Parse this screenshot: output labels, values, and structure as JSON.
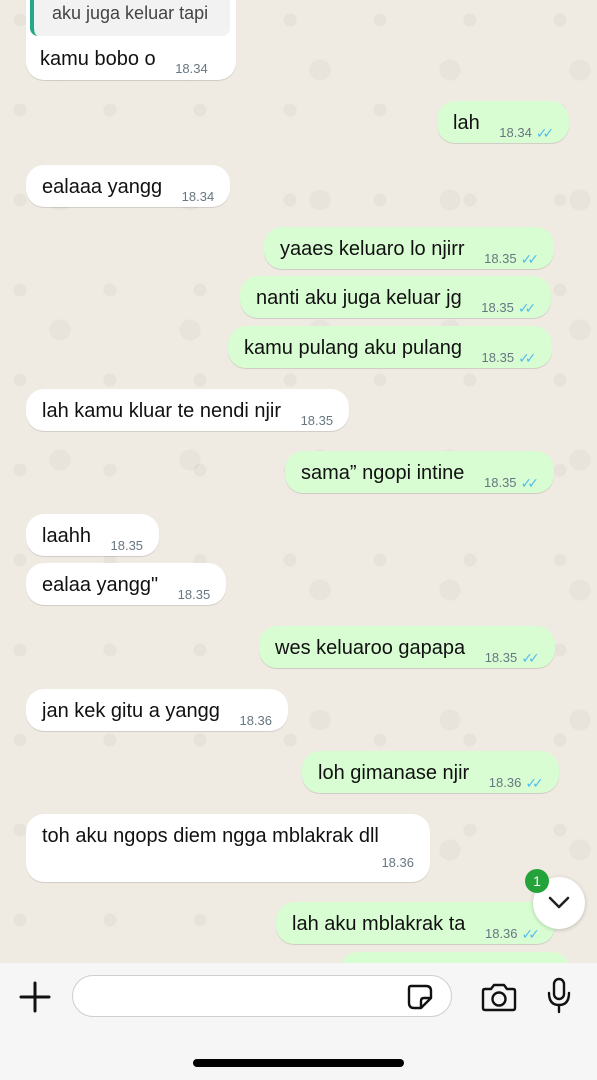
{
  "reply_quote": "aku juga keluar tapi",
  "messages": [
    {
      "dir": "in",
      "text": "kamu bobo o",
      "time": "18.34"
    },
    {
      "dir": "out",
      "text": "lah",
      "time": "18.34"
    },
    {
      "dir": "in",
      "text": "ealaaa yangg",
      "time": "18.34"
    },
    {
      "dir": "out",
      "text": "yaaes keluaro lo njirr",
      "time": "18.35"
    },
    {
      "dir": "out",
      "text": "nanti aku juga keluar jg",
      "time": "18.35"
    },
    {
      "dir": "out",
      "text": "kamu pulang aku pulang",
      "time": "18.35"
    },
    {
      "dir": "in",
      "text": "lah kamu kluar te nendi njir",
      "time": "18.35"
    },
    {
      "dir": "out",
      "text": "sama” ngopi intine",
      "time": "18.35"
    },
    {
      "dir": "in",
      "text": "laahh",
      "time": "18.35"
    },
    {
      "dir": "in",
      "text": "ealaa yangg\"",
      "time": "18.35"
    },
    {
      "dir": "out",
      "text": "wes keluaroo gapapa",
      "time": "18.35"
    },
    {
      "dir": "in",
      "text": "jan kek gitu a yangg",
      "time": "18.36"
    },
    {
      "dir": "out",
      "text": "loh gimanase njir",
      "time": "18.36"
    },
    {
      "dir": "in",
      "text": "toh aku ngops diem ngga mblakrak dll",
      "time": "18.36"
    },
    {
      "dir": "out",
      "text": "lah aku mblakrak ta",
      "time": "18.36"
    }
  ],
  "unread_count": "1",
  "colors": {
    "incoming": "#ffffff",
    "outgoing": "#d9fdd3",
    "ticks": "#53bdeb",
    "badge": "#25a33b"
  },
  "icons": {
    "attach": "plus-icon",
    "sticker": "sticker-icon",
    "camera": "camera-icon",
    "mic": "microphone-icon",
    "scroll": "chevron-down-icon",
    "read": "double-check-icon"
  },
  "composer": {
    "placeholder": ""
  }
}
